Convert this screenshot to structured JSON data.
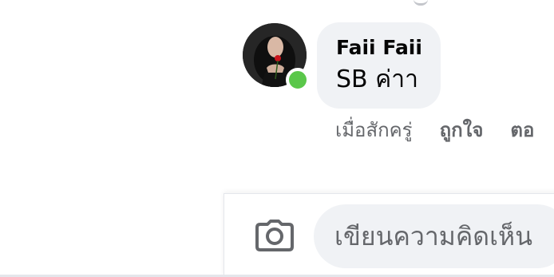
{
  "comment": {
    "author": "Faii Faii",
    "text": "SB ค่าา",
    "status": "online"
  },
  "actions": {
    "timestamp": "เมื่อสักครู่",
    "like_label": "ถูกใจ",
    "reply_label": "ตอ"
  },
  "composer": {
    "placeholder": "เขียนความคิดเห็น"
  },
  "icons": {
    "camera": "camera-icon",
    "presence": "online-status-dot"
  },
  "colors": {
    "bubble": "#f0f2f5",
    "online": "#5ac74a",
    "meta_text": "#65676b",
    "primary_text": "#050505"
  }
}
